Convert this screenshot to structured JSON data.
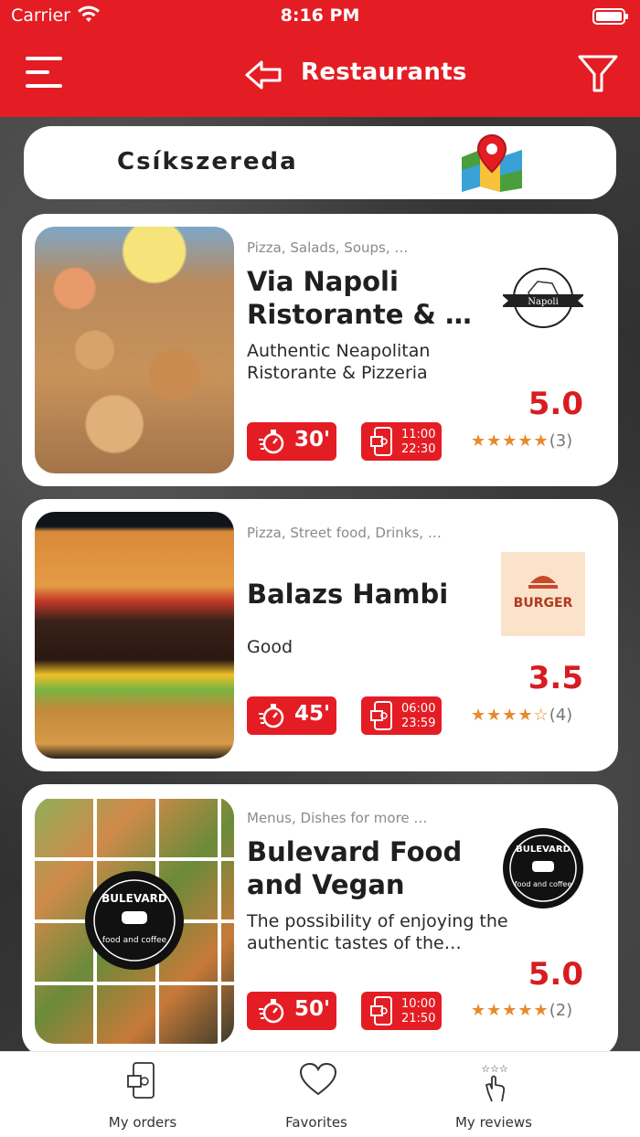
{
  "status_bar": {
    "carrier": "Carrier",
    "time": "8:16 PM"
  },
  "header": {
    "title": "Restaurants",
    "bg_color": "#e41d24"
  },
  "location": {
    "city": "Csíkszereda"
  },
  "restaurants": [
    {
      "categories": "Pizza, Salads, Soups, …",
      "name": "Via Napoli Ristorante & …",
      "description": "Authentic Neapolitan Ristorante & Pizzeria",
      "delivery_time": "30'",
      "open": "11:00",
      "close": "22:30",
      "rating": "5.0",
      "stars": "★★★★★",
      "review_count": "(3)"
    },
    {
      "categories": "Pizza, Street food, Drinks, …",
      "name": "Balazs Hambi",
      "description": "Good",
      "delivery_time": "45'",
      "open": "06:00",
      "close": "23:59",
      "rating": "3.5",
      "stars": "★★★★☆",
      "review_count": "(4)"
    },
    {
      "categories": "Menus, Dishes for more …",
      "name": "Bulevard Food and Vegan",
      "description": "The possibility of enjoying the authentic tastes of the…",
      "delivery_time": "50'",
      "open": "10:00",
      "close": "21:50",
      "rating": "5.0",
      "stars": "★★★★★",
      "review_count": "(2)"
    }
  ],
  "tabbar": {
    "orders": "My orders",
    "favorites": "Favorites",
    "reviews": "My reviews"
  },
  "logos": {
    "napoli_text": "Napoli",
    "burger_text": "BURGER",
    "bulevard_text": "BULEVARD",
    "bulevard_sub": "food and coffee"
  }
}
